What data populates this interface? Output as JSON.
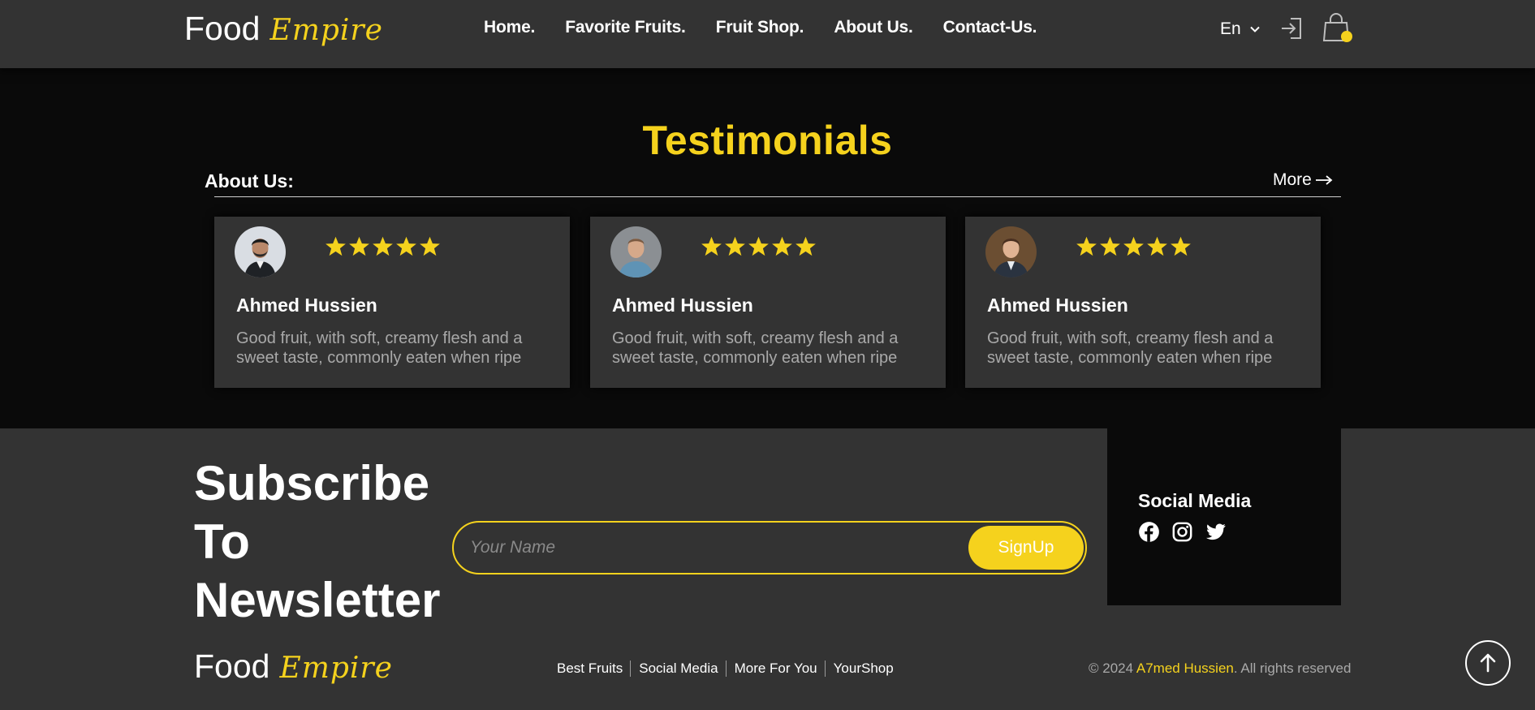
{
  "brand": {
    "word1": "Food",
    "word2": "Empire"
  },
  "nav": {
    "links": [
      "Home.",
      "Favorite Fruits.",
      "Fruit Shop.",
      "About Us.",
      "Contact-Us."
    ],
    "language": "En",
    "icons": [
      "chevron-down-icon",
      "login-icon",
      "shopping-bag-icon"
    ]
  },
  "testimonials": {
    "title": "Testimonials",
    "subtitle": "About Us:",
    "more_label": "More",
    "cards": [
      {
        "name": "Ahmed Hussien",
        "text": "Good fruit, with soft, creamy flesh and a sweet taste, commonly eaten when ripe",
        "rating": 5
      },
      {
        "name": "Ahmed Hussien",
        "text": "Good fruit, with soft, creamy flesh and a sweet taste, commonly eaten when ripe",
        "rating": 5
      },
      {
        "name": "Ahmed Hussien",
        "text": "Good fruit, with soft, creamy flesh and a sweet taste, commonly eaten when ripe",
        "rating": 5
      }
    ]
  },
  "newsletter": {
    "title_lines": [
      "Subscribe",
      "To",
      "Newsletter"
    ],
    "placeholder": "Your Name",
    "button_label": "SignUp"
  },
  "social": {
    "title": "Social Media",
    "icons": [
      "facebook-icon",
      "instagram-icon",
      "twitter-icon"
    ]
  },
  "footer": {
    "links": [
      "Best Fruits",
      "Social Media",
      "More For You",
      "YourShop"
    ],
    "copyright_prefix": "© 2024 ",
    "copyright_author": "A7med Hussien",
    "copyright_suffix": ". All rights reserved"
  },
  "colors": {
    "accent": "#f5d21d",
    "panel": "#333333",
    "background": "#0a0a0a",
    "muted_text": "#a9a9a9"
  }
}
